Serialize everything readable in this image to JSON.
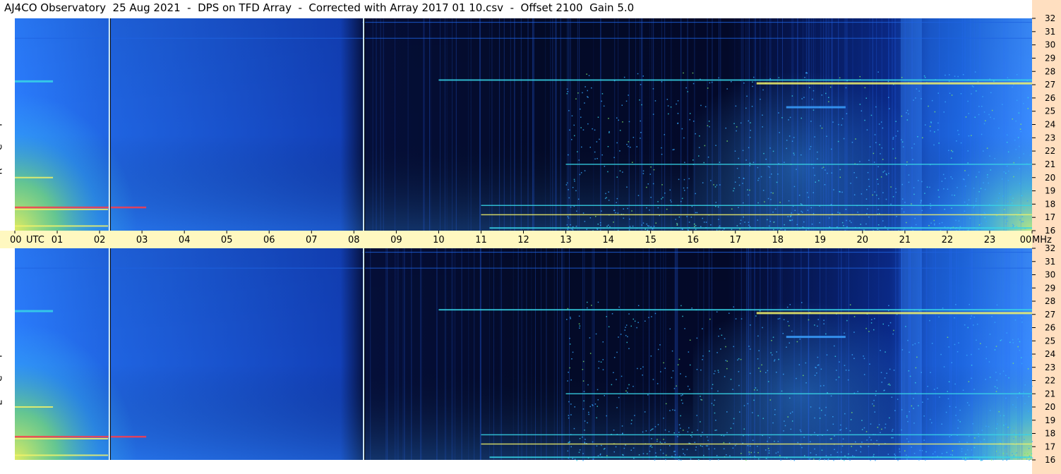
{
  "header": {
    "title": "AJ4CO Observatory  25 Aug 2021  -  DPS on TFD Array  -  Corrected with Array 2017 01 10.csv  -  Offset 2100  Gain 5.0"
  },
  "panels": {
    "top_label": [
      "R",
      "C",
      "P"
    ],
    "bottom_label": [
      "L",
      "C",
      "P"
    ]
  },
  "chart_data": {
    "type": "heatmap",
    "title": "AJ4CO Observatory  25 Aug 2021  -  DPS on TFD Array  -  Corrected with Array 2017 01 10.csv  -  Offset 2100  Gain 5.0",
    "x_axis": {
      "label_left": "UTC",
      "unit_right": "MHz",
      "ticks": [
        "00",
        "01",
        "02",
        "03",
        "04",
        "05",
        "06",
        "07",
        "08",
        "09",
        "10",
        "11",
        "12",
        "13",
        "14",
        "15",
        "16",
        "17",
        "18",
        "19",
        "20",
        "21",
        "22",
        "23",
        "00"
      ],
      "range_hours": [
        0,
        24
      ]
    },
    "y_axis": {
      "unit": "MHz",
      "ticks": [
        32,
        31,
        30,
        29,
        28,
        27,
        26,
        25,
        24,
        23,
        22,
        21,
        20,
        19,
        18,
        17,
        16
      ],
      "range_mhz": [
        16,
        32
      ]
    },
    "series": [
      {
        "name": "RCP",
        "panel": "top"
      },
      {
        "name": "LCP",
        "panel": "bottom"
      }
    ],
    "markers_utc": [
      2.23,
      8.23
    ],
    "colors": {
      "dark": "#000a2e",
      "blue": "#1f63e0",
      "light_blue": "#3aa0ff",
      "cyan": "#37d6e8",
      "green": "#7ee86a",
      "yellow": "#f2f26a",
      "red": "#ff3b4a",
      "axis_strip": "#fff8c0",
      "right_axis": "#ffdfc0",
      "marker_line": "#d8f4ff"
    }
  }
}
